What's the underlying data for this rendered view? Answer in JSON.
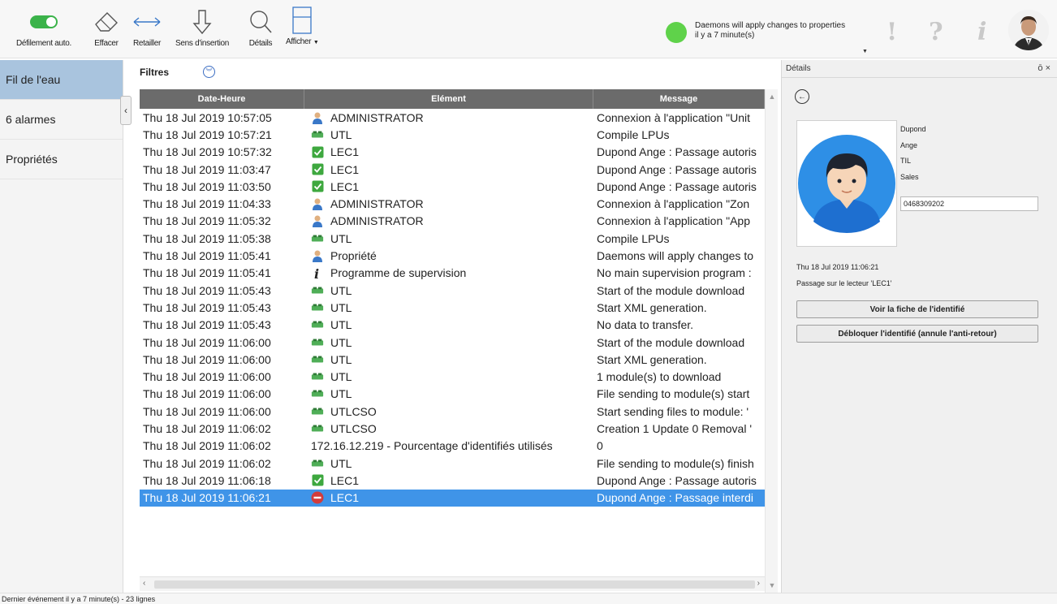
{
  "toolbar": {
    "buttons": [
      {
        "label": "Défilement auto.",
        "icon": "toggle-switch-icon"
      },
      {
        "label": "Effacer",
        "icon": "eraser-icon"
      },
      {
        "label": "Retailler",
        "icon": "resize-arrows-icon"
      },
      {
        "label": "Sens d'insertion",
        "icon": "down-arrow-icon"
      },
      {
        "label": "Détails",
        "icon": "magnifier-icon"
      },
      {
        "label": "Afficher",
        "icon": "panel-layout-icon"
      }
    ]
  },
  "status": {
    "message": "Daemons will apply changes to properties",
    "time": "il y a 7 minute(s)",
    "color": "#5fd24a"
  },
  "header_icons": [
    "exclamation-icon",
    "question-icon",
    "info-icon",
    "user-avatar-icon"
  ],
  "nav": {
    "items": [
      {
        "label": "Fil de l'eau",
        "active": true
      },
      {
        "label": "6 alarmes",
        "active": false
      },
      {
        "label": "Propriétés",
        "active": false
      }
    ]
  },
  "filters": {
    "label": "Filtres"
  },
  "grid": {
    "columns": [
      "Date-Heure",
      "Elément",
      "Message"
    ],
    "rows": [
      {
        "date": "Thu 18 Jul 2019 10:57:05",
        "icon": "user",
        "element": "ADMINISTRATOR",
        "message": "Connexion à l'application \"Unit"
      },
      {
        "date": "Thu 18 Jul 2019 10:57:21",
        "icon": "module",
        "element": "UTL",
        "message": "Compile LPUs"
      },
      {
        "date": "Thu 18 Jul 2019 10:57:32",
        "icon": "check",
        "element": "LEC1",
        "message": "Dupond Ange : Passage autoris"
      },
      {
        "date": "Thu 18 Jul 2019 11:03:47",
        "icon": "check",
        "element": "LEC1",
        "message": "Dupond Ange : Passage autoris"
      },
      {
        "date": "Thu 18 Jul 2019 11:03:50",
        "icon": "check",
        "element": "LEC1",
        "message": "Dupond Ange : Passage autoris"
      },
      {
        "date": "Thu 18 Jul 2019 11:04:33",
        "icon": "user",
        "element": "ADMINISTRATOR",
        "message": "Connexion à l'application \"Zon"
      },
      {
        "date": "Thu 18 Jul 2019 11:05:32",
        "icon": "user",
        "element": "ADMINISTRATOR",
        "message": "Connexion à l'application \"App"
      },
      {
        "date": "Thu 18 Jul 2019 11:05:38",
        "icon": "module",
        "element": "UTL",
        "message": "Compile LPUs"
      },
      {
        "date": "Thu 18 Jul 2019 11:05:41",
        "icon": "user",
        "element": "Propriété",
        "message": "Daemons will apply changes to"
      },
      {
        "date": "Thu 18 Jul 2019 11:05:41",
        "icon": "info",
        "element": "Programme de supervision",
        "message": "No main supervision program :"
      },
      {
        "date": "Thu 18 Jul 2019 11:05:43",
        "icon": "module",
        "element": "UTL",
        "message": "Start of the module download"
      },
      {
        "date": "Thu 18 Jul 2019 11:05:43",
        "icon": "module",
        "element": "UTL",
        "message": "Start XML generation."
      },
      {
        "date": "Thu 18 Jul 2019 11:05:43",
        "icon": "module",
        "element": "UTL",
        "message": "No data to transfer."
      },
      {
        "date": "Thu 18 Jul 2019 11:06:00",
        "icon": "module",
        "element": "UTL",
        "message": "Start of the module download"
      },
      {
        "date": "Thu 18 Jul 2019 11:06:00",
        "icon": "module",
        "element": "UTL",
        "message": "Start XML generation."
      },
      {
        "date": "Thu 18 Jul 2019 11:06:00",
        "icon": "module",
        "element": "UTL",
        "message": "1 module(s) to download"
      },
      {
        "date": "Thu 18 Jul 2019 11:06:00",
        "icon": "module",
        "element": "UTL",
        "message": "File sending to module(s) start"
      },
      {
        "date": "Thu 18 Jul 2019 11:06:00",
        "icon": "module",
        "element": "UTLCSO",
        "message": "Start sending files to module: '"
      },
      {
        "date": "Thu 18 Jul 2019 11:06:02",
        "icon": "module",
        "element": "UTLCSO",
        "message": "Creation 1 Update 0 Removal '"
      },
      {
        "date": "Thu 18 Jul 2019 11:06:02",
        "icon": "none",
        "element": "172.16.12.219 - Pourcentage d'identifiés utilisés",
        "message": "0"
      },
      {
        "date": "Thu 18 Jul 2019 11:06:02",
        "icon": "module",
        "element": "UTL",
        "message": "File sending to module(s) finish"
      },
      {
        "date": "Thu 18 Jul 2019 11:06:18",
        "icon": "check",
        "element": "LEC1",
        "message": "Dupond Ange : Passage autoris"
      },
      {
        "date": "Thu 18 Jul 2019 11:06:21",
        "icon": "denied",
        "element": "LEC1",
        "message": "Dupond Ange : Passage interdi",
        "selected": true
      }
    ]
  },
  "details": {
    "title": "Détails",
    "controls": "ō ×",
    "lastname": "Dupond",
    "firstname": "Ange",
    "company": "TIL",
    "department": "Sales",
    "badge": "0468309202",
    "event_time": "Thu 18 Jul 2019 11:06:21",
    "event_desc": "Passage sur le lecteur 'LEC1'",
    "btn_view": "Voir la fiche de l'identifié",
    "btn_unlock": "Débloquer l'identifié (annule l'anti-retour)"
  },
  "statusbar": {
    "text": "Dernier événement il y a 7 minute(s)  -  23 lignes"
  }
}
